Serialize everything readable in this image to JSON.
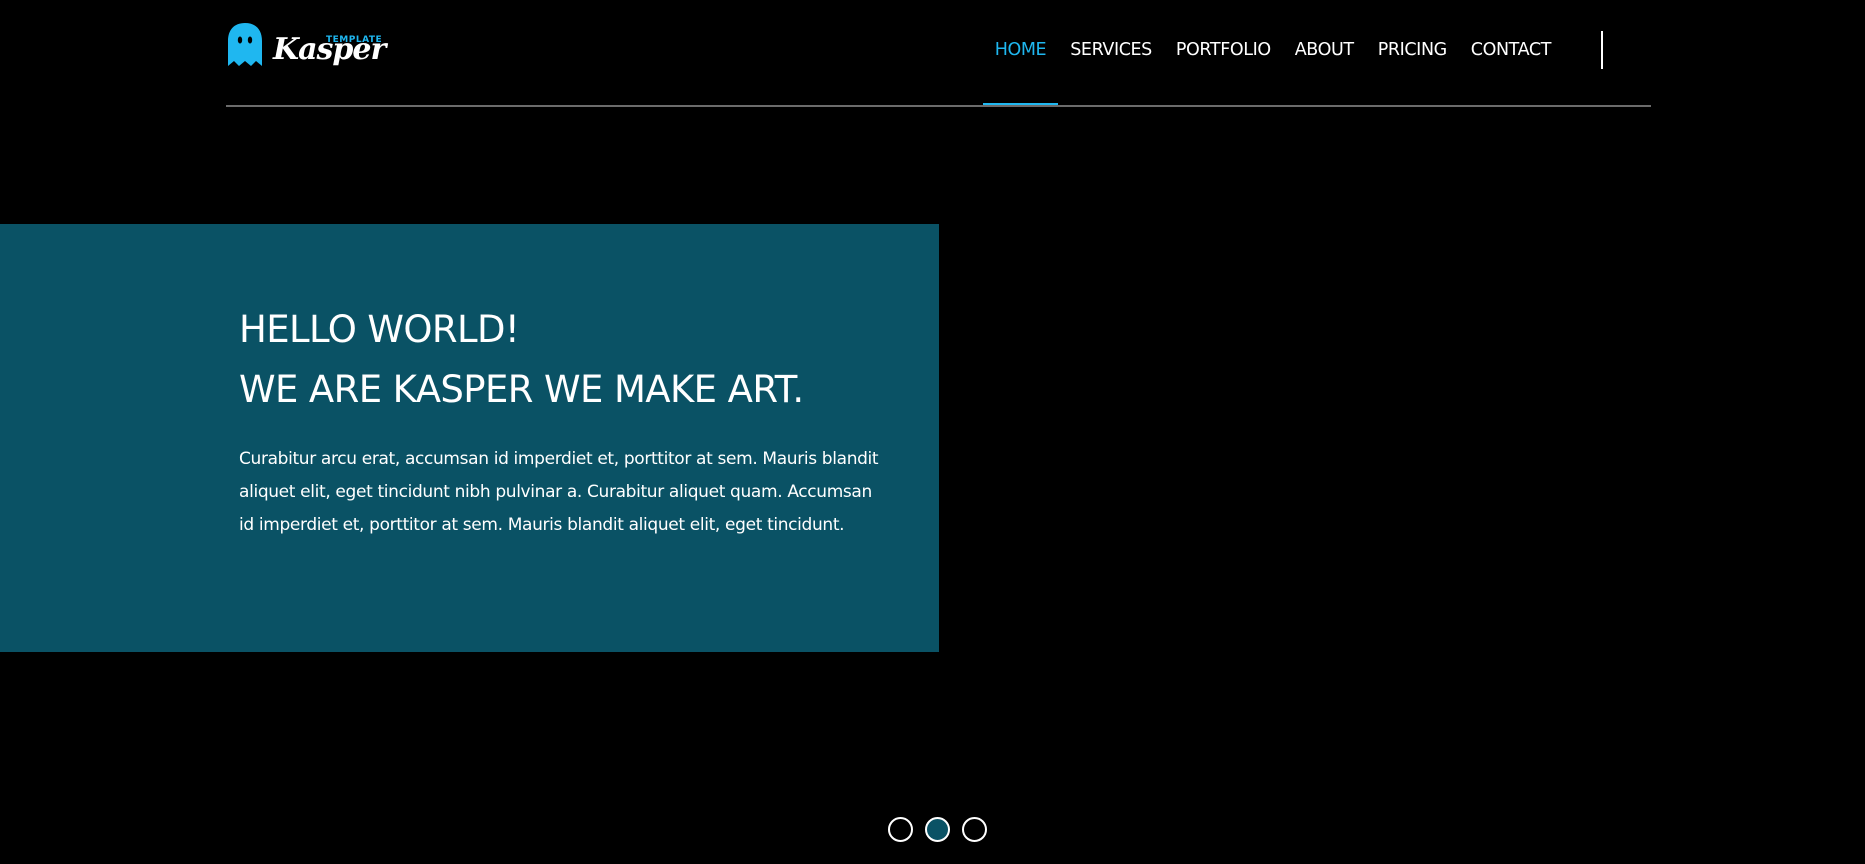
{
  "brand": {
    "name": "Kasper",
    "tag": "TEMPLATE",
    "ghost_color": "#1fb7f0"
  },
  "nav": {
    "items": [
      {
        "label": "HOME",
        "active": true
      },
      {
        "label": "SERVICES",
        "active": false
      },
      {
        "label": "PORTFOLIO",
        "active": false
      },
      {
        "label": "ABOUT",
        "active": false
      },
      {
        "label": "PRICING",
        "active": false
      },
      {
        "label": "CONTACT",
        "active": false
      }
    ],
    "active_color": "#1fb7f0"
  },
  "hero": {
    "title_line1": "HELLO WORLD!",
    "title_line2": "WE ARE KASPER WE MAKE ART.",
    "text": "Curabitur arcu erat, accumsan id imperdiet et, porttitor at sem. Mauris blandit aliquet elit, eget tincidunt nibh pulvinar a. Curabitur aliquet quam. Accumsan id imperdiet et, porttitor at sem. Mauris blandit aliquet elit, eget tincidunt.",
    "box_color": "#0a5265"
  },
  "slider": {
    "count": 3,
    "active_index": 1
  }
}
